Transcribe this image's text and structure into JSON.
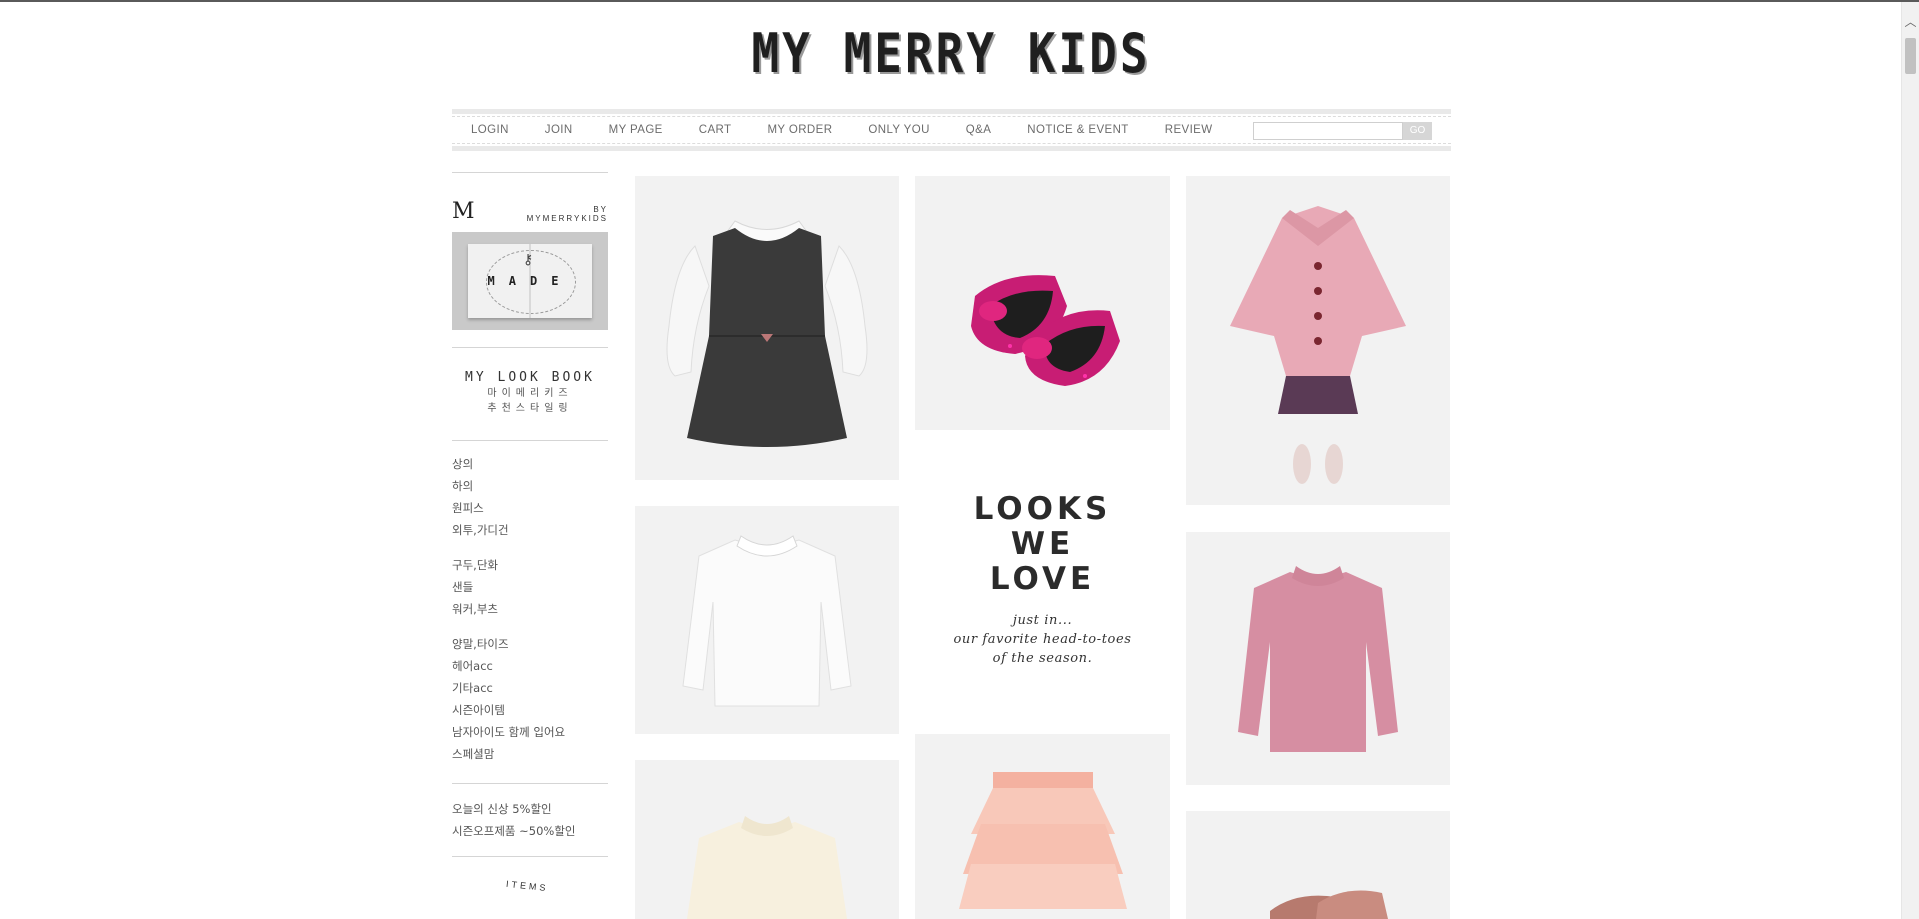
{
  "site": {
    "logo": "MY MERRY KIDS"
  },
  "nav": {
    "items": [
      "LOGIN",
      "JOIN",
      "MY PAGE",
      "CART",
      "MY ORDER",
      "ONLY YOU",
      "Q&A",
      "NOTICE & EVENT",
      "REVIEW"
    ],
    "search_placeholder": "",
    "go_label": "GO"
  },
  "sidebar": {
    "made_by": {
      "mark": "M",
      "by_line1": "BY",
      "by_line2": "MYMERRYKIDS",
      "image_text": "MADE"
    },
    "lookbook": {
      "title": "MY LOOK BOOK",
      "ko_line1": "마이메리키즈",
      "ko_line2": "추천스타일링"
    },
    "categories_1": [
      "상의",
      "하의",
      "원피스",
      "외투,가디건"
    ],
    "categories_2": [
      "구두,단화",
      "샌들",
      "워커,부츠"
    ],
    "categories_3": [
      "양말,타이즈",
      "헤어acc",
      "기타acc",
      "시즌아이템",
      "남자아이도 함께 입어요",
      "스페셜맘"
    ],
    "promos": [
      "오늘의 신상 5%할인",
      "시즌오프제품 ~50%할인"
    ],
    "items_arc": "ITEMS"
  },
  "feature": {
    "title_lines": [
      "LOOKS",
      "WE",
      "LOVE"
    ],
    "sub_lines": [
      "just in...",
      "our favorite head-to-toes",
      "of the season."
    ]
  },
  "colors": {
    "accent_pink": "#c81d74",
    "dark": "#2b2b2b",
    "nav_text": "#6c6c6c"
  },
  "icons": {
    "scroll_up": "chevron-up-icon"
  }
}
